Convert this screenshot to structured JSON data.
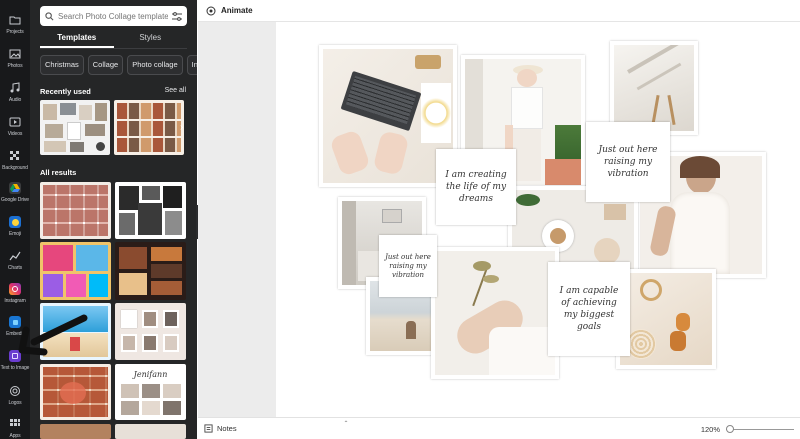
{
  "rail": {
    "items": [
      {
        "label": "Projects",
        "icon": "folder-icon"
      },
      {
        "label": "Photos",
        "icon": "photo-icon"
      },
      {
        "label": "Audio",
        "icon": "music-icon"
      },
      {
        "label": "Videos",
        "icon": "video-icon"
      },
      {
        "label": "Background",
        "icon": "background-icon"
      },
      {
        "label": "Google Drive",
        "icon": "google-drive-icon"
      },
      {
        "label": "Emoji",
        "icon": "emoji-icon"
      },
      {
        "label": "Charts",
        "icon": "chart-icon"
      },
      {
        "label": "Instagram",
        "icon": "instagram-icon"
      },
      {
        "label": "Embeds",
        "icon": "embeds-icon"
      },
      {
        "label": "Text to Image",
        "icon": "text-to-image-icon"
      },
      {
        "label": "Logos",
        "icon": "logos-icon"
      },
      {
        "label": "Apps",
        "icon": "apps-icon"
      }
    ]
  },
  "panel": {
    "search_placeholder": "Search Photo Collage templates",
    "tabs": [
      "Templates",
      "Styles"
    ],
    "chips": [
      "Christmas",
      "Collage",
      "Photo collage",
      "Ins"
    ],
    "recently_used": "Recently used",
    "see_all": "See all",
    "all_results": "All results",
    "template_name_script": "Jenifann"
  },
  "topbar": {
    "animate_label": "Animate"
  },
  "canvas": {
    "quotes": [
      "I am creating the life of my dreams",
      "Just out here raising my vibration",
      "Just out here raising my vibration",
      "I am capable of achieving my biggest goals"
    ]
  },
  "bottombar": {
    "notes_label": "Notes",
    "zoom": "120%"
  }
}
